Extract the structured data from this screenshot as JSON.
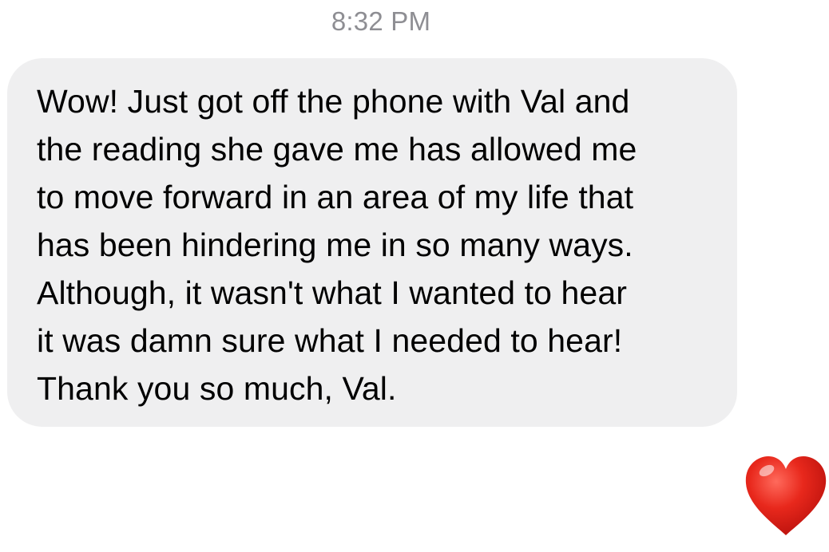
{
  "thread": {
    "timestamp": "8:32 PM"
  },
  "message": {
    "lines": [
      "Wow! Just got off the phone with Val and",
      "the reading she gave me has allowed me",
      "to move forward in an area of my life that",
      "has been hindering me in so many ways.",
      "Although, it wasn't what I wanted to hear",
      "it was damn sure what I needed to hear!",
      "Thank you so much, Val."
    ]
  },
  "reaction": {
    "icon": "red-heart-emoji-icon",
    "colors": {
      "heart": "#e0251b",
      "bubble": "#efeff0",
      "timestamp": "#8e8e93"
    }
  }
}
